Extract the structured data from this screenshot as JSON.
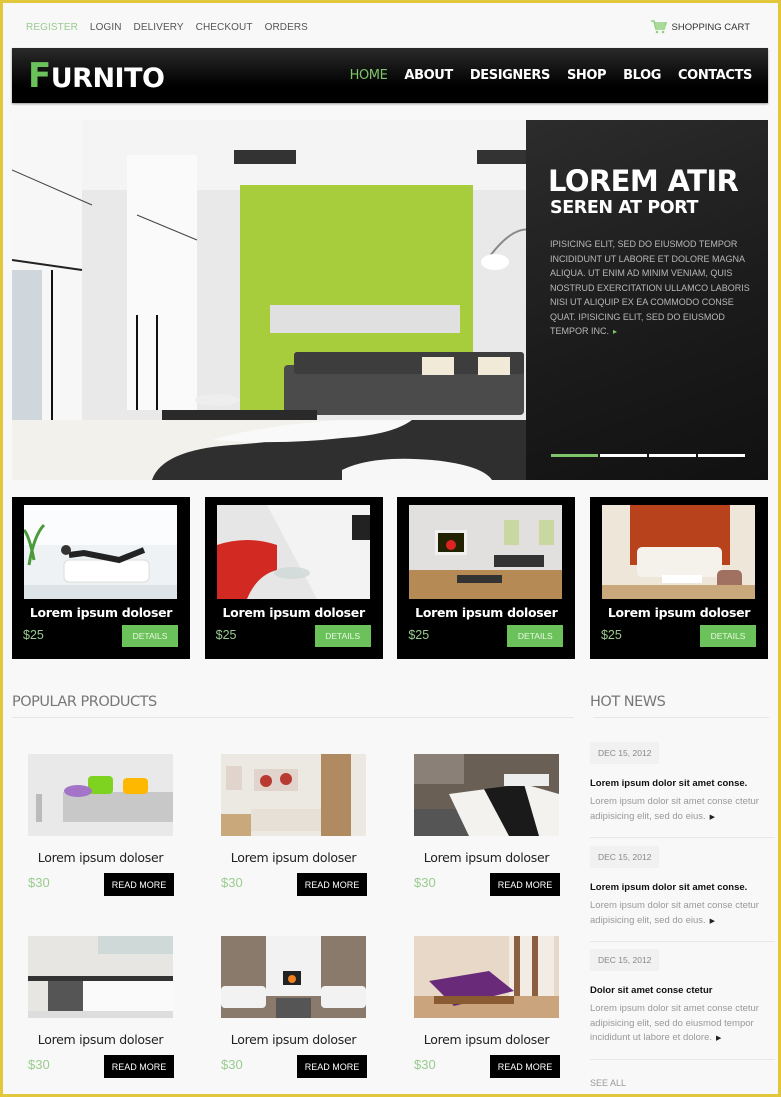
{
  "top_links": [
    "REGISTER",
    "LOGIN",
    "DELIVERY",
    "CHECKOUT",
    "ORDERS"
  ],
  "cart": {
    "label": "SHOPPING CART",
    "icon": "shopping-cart-icon"
  },
  "logo": {
    "first_letter": "F",
    "rest": "URNITO"
  },
  "nav": [
    "HOME",
    "ABOUT",
    "DESIGNERS",
    "SHOP",
    "BLOG",
    "CONTACTS"
  ],
  "nav_active": "HOME",
  "hero": {
    "title": "LOREM ATIR",
    "subtitle": "SEREN AT PORT",
    "text": "IPISICING ELIT, SED DO EIUSMOD TEMPOR INCIDIDUNT UT LABORE ET DOLORE MAGNA ALIQUA. UT ENIM AD MINIM VENIAM, QUIS NOSTRUD EXERCITATION ULLAMCO LABORIS NISI UT ALIQUIP EX EA COMMODO CONSE QUAT. IPISICING ELIT, SED DO EIUSMOD TEMPOR INC.",
    "arrow": "▸",
    "slides": 4,
    "active_slide": 1
  },
  "featured": [
    {
      "name": "Lorem ipsum doloser",
      "price": "$25",
      "button": "DETAILS"
    },
    {
      "name": "Lorem ipsum doloser",
      "price": "$25",
      "button": "DETAILS"
    },
    {
      "name": "Lorem ipsum doloser",
      "price": "$25",
      "button": "DETAILS"
    },
    {
      "name": "Lorem ipsum doloser",
      "price": "$25",
      "button": "DETAILS"
    }
  ],
  "popular": {
    "title": "POPULAR PRODUCTS",
    "items": [
      {
        "name": "Lorem ipsum doloser",
        "price": "$30",
        "button": "READ MORE"
      },
      {
        "name": "Lorem ipsum doloser",
        "price": "$30",
        "button": "READ MORE"
      },
      {
        "name": "Lorem ipsum doloser",
        "price": "$30",
        "button": "READ MORE"
      },
      {
        "name": "Lorem ipsum doloser",
        "price": "$30",
        "button": "READ MORE"
      },
      {
        "name": "Lorem ipsum doloser",
        "price": "$30",
        "button": "READ MORE"
      },
      {
        "name": "Lorem ipsum doloser",
        "price": "$30",
        "button": "READ MORE"
      }
    ]
  },
  "hot_news": {
    "title": "HOT NEWS",
    "items": [
      {
        "date": "DEC 15, 2012",
        "title": "Lorem ipsum dolor sit amet conse.",
        "text": "Lorem ipsum dolor sit amet conse ctetur adipisicing elit, sed do eius."
      },
      {
        "date": "DEC 15, 2012",
        "title": "Lorem ipsum dolor sit amet conse.",
        "text": "Lorem ipsum dolor sit amet conse ctetur adipisicing elit, sed do eius."
      },
      {
        "date": "DEC 15, 2012",
        "title": "Dolor sit amet conse ctetur",
        "text": "Lorem ipsum dolor sit amet conse ctetur adipisicing elit, sed do eiusmod tempor incididunt ut labore et dolore."
      }
    ],
    "see_all": "SEE ALL"
  },
  "colors": {
    "accent": "#6cc25a",
    "accent_light": "#9acb8f",
    "border": "#e2c63c",
    "dark": "#000000"
  }
}
